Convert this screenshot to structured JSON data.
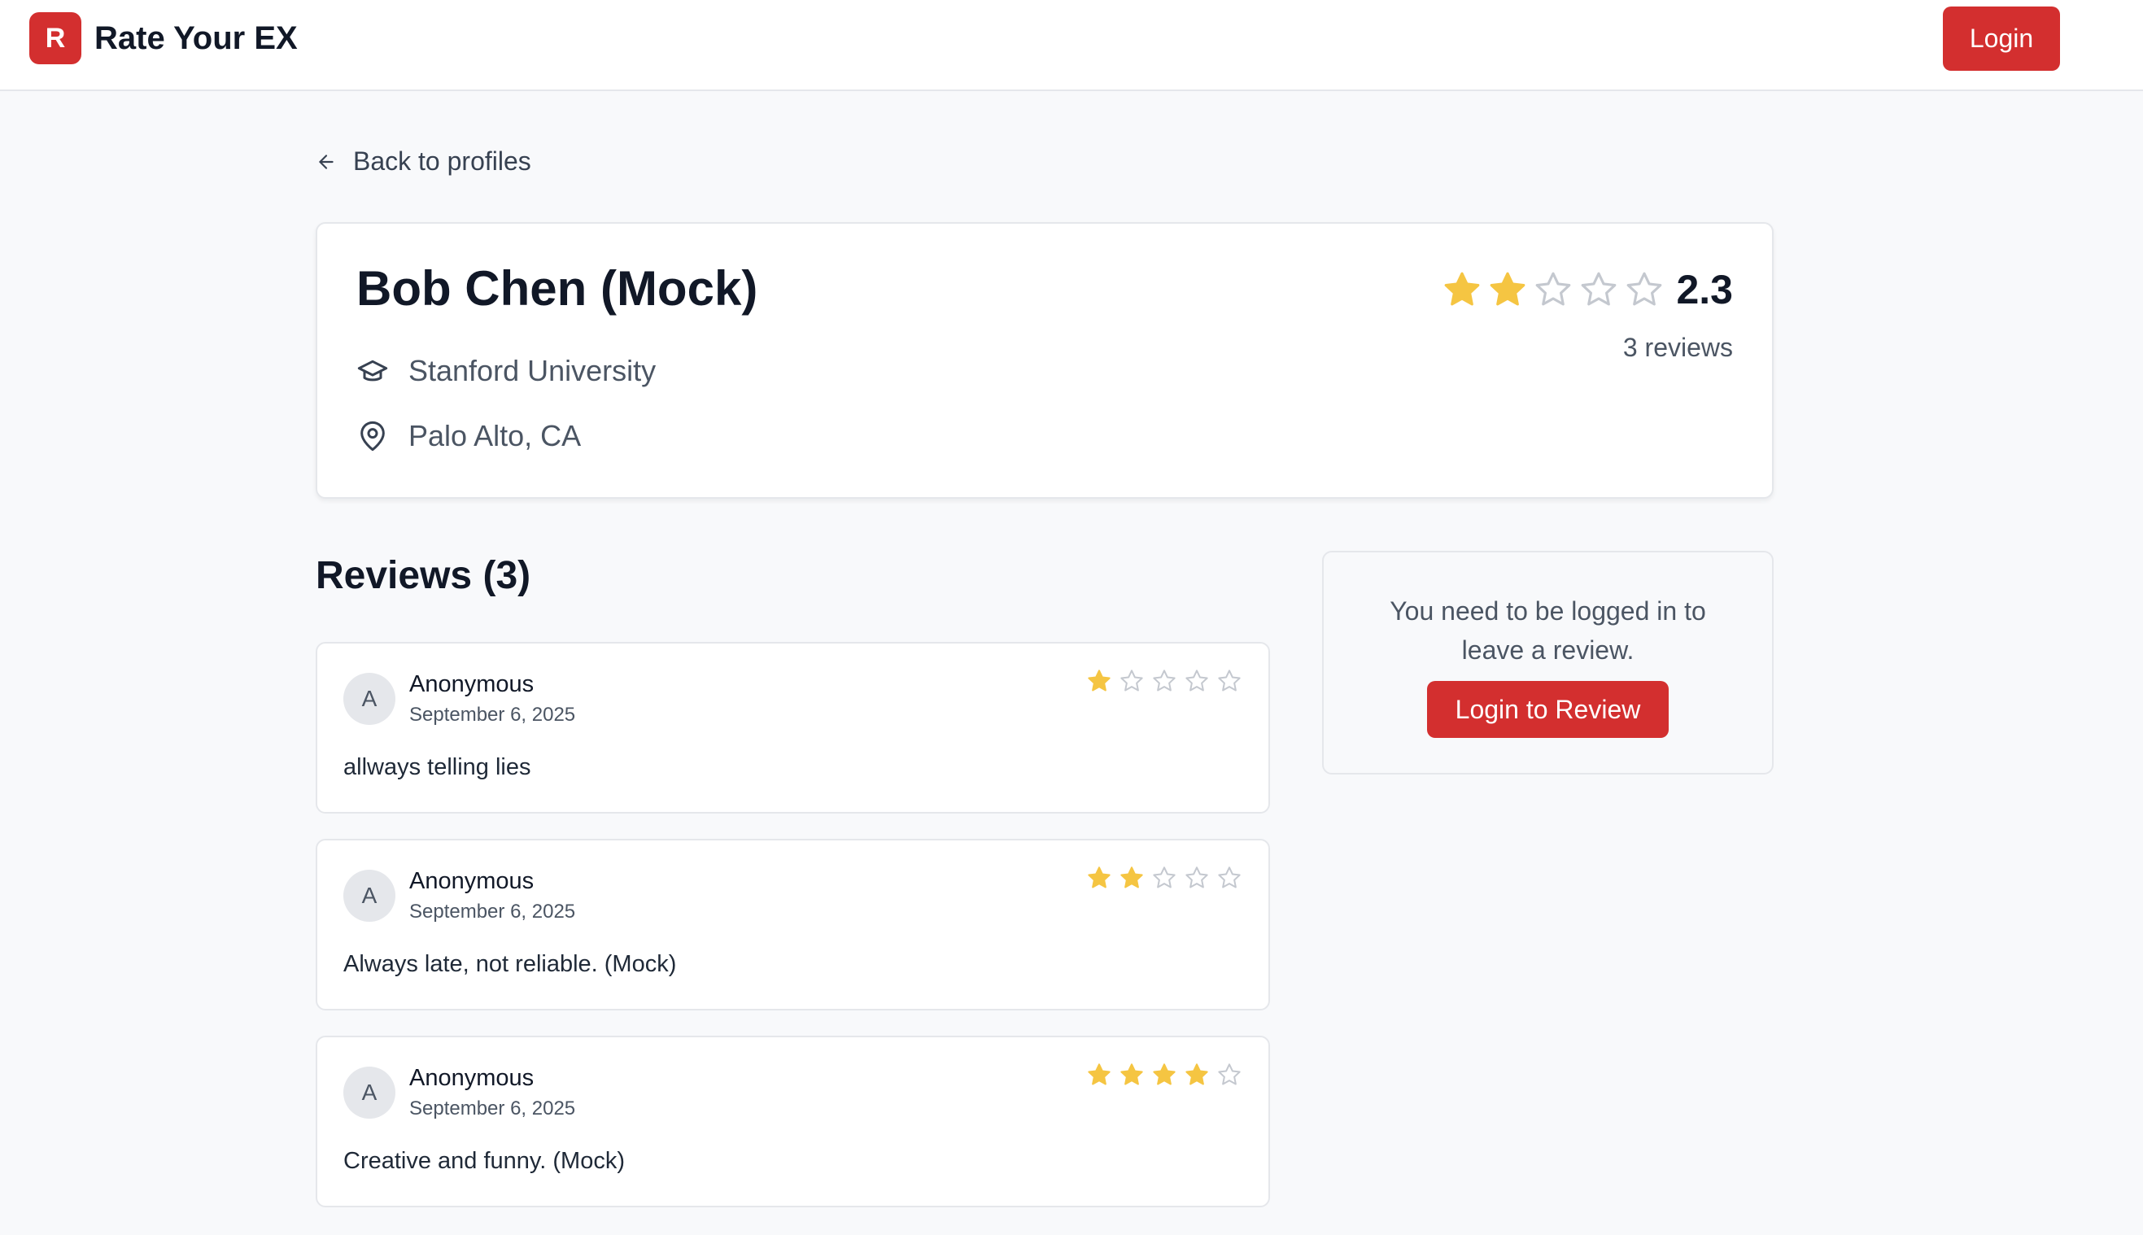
{
  "header": {
    "logo_letter": "R",
    "app_name": "Rate Your EX",
    "login_label": "Login"
  },
  "nav": {
    "back_label": "Back to profiles"
  },
  "profile": {
    "name": "Bob Chen (Mock)",
    "school": "Stanford University",
    "location": "Palo Alto, CA",
    "rating_value": "2.3",
    "rating_stars_filled": 2,
    "rating_stars_total": 5,
    "review_count_label": "3 reviews"
  },
  "reviews": {
    "heading": "Reviews (3)",
    "items": [
      {
        "avatar_initial": "A",
        "author": "Anonymous",
        "date": "September 6, 2025",
        "stars": 1,
        "text": "allways telling lies"
      },
      {
        "avatar_initial": "A",
        "author": "Anonymous",
        "date": "September 6, 2025",
        "stars": 2,
        "text": "Always late, not reliable. (Mock)"
      },
      {
        "avatar_initial": "A",
        "author": "Anonymous",
        "date": "September 6, 2025",
        "stars": 4,
        "text": "Creative and funny. (Mock)"
      }
    ]
  },
  "login_prompt": {
    "message": "You need to be logged in to leave a review.",
    "button_label": "Login to Review"
  },
  "colors": {
    "brand": "#d32f2f",
    "star_filled": "#f5c542",
    "star_empty": "#c4c8cf",
    "background": "#f8f9fb"
  }
}
